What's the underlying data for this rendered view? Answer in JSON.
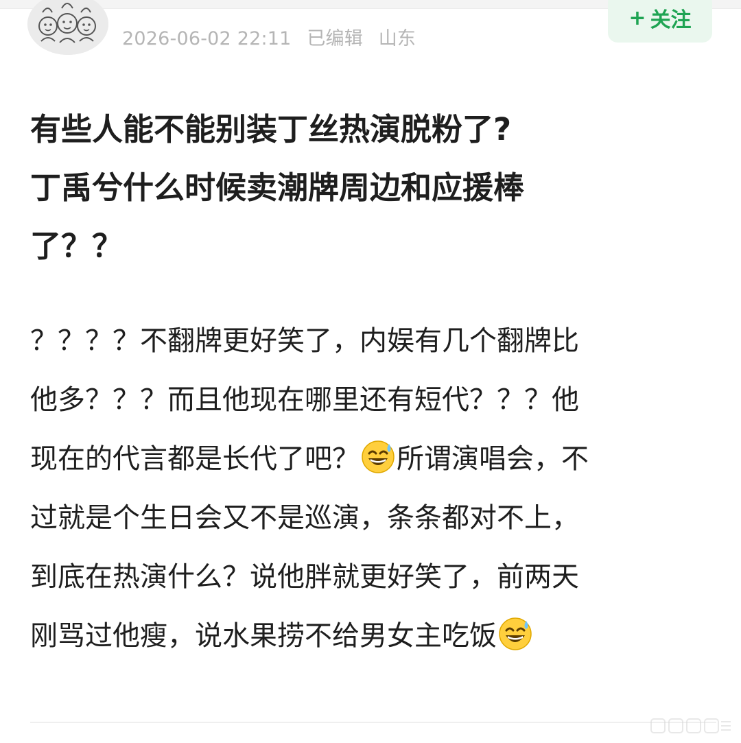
{
  "post": {
    "author": {
      "name": "",
      "avatar_icon": "cartoon-group-avatar-icon"
    },
    "meta": {
      "datetime": "2026-06-02 22:11",
      "edited": "已编辑",
      "location": "山东"
    },
    "follow_button": {
      "icon": "+",
      "label": "关注"
    },
    "title_lines": [
      "有些人能不能别装丁丝热演脱粉了?",
      "丁禹兮什么时候卖潮牌周边和应援棒",
      "了？？"
    ],
    "body": {
      "line1": "？？？？不翻牌更好笑了，内娱有几个翻牌比",
      "line2": "他多？？？而且他现在哪里还有短代？？？他",
      "line3_a": "现在的代言都是长代了吧？",
      "line3_b": "所谓演唱会，不",
      "line4": "过就是个生日会又不是巡演，条条都对不上，",
      "line5": "到底在热演什么？说他胖就更好笑了，前两天",
      "line6": "刚骂过他瘦，说水果捞不给男女主吃饭",
      "emoji_name": "sweat-smile-emoji-icon"
    }
  },
  "colors": {
    "follow_text": "#1fa453",
    "follow_bg": "#eaf7ee",
    "meta_text": "#b5b5b5",
    "body_text": "#1e1e1e"
  }
}
